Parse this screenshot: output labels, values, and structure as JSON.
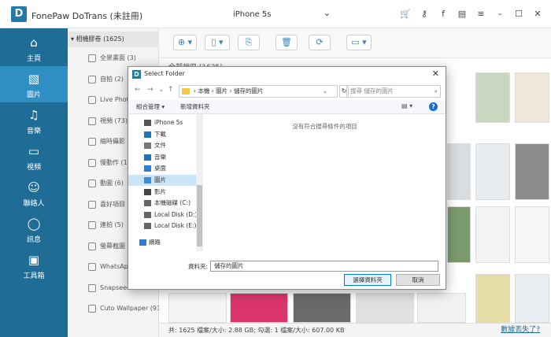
{
  "app": {
    "logo": "D",
    "title": "FonePaw DoTrans (未註冊)",
    "device": "iPhone 5s",
    "title_icons": [
      "cart-icon",
      "key-icon",
      "facebook-icon",
      "chat-icon",
      "menu-icon",
      "minimize-icon",
      "maximize-icon",
      "close-icon"
    ],
    "title_glyphs": [
      "🛒",
      "⚷",
      "f",
      "▤",
      "≡",
      "–",
      "☐",
      "✕"
    ]
  },
  "nav": [
    {
      "label": "主頁",
      "icon": "home-icon",
      "glyph": "⌂"
    },
    {
      "label": "圖片",
      "icon": "photo-icon",
      "glyph": "▧",
      "active": true
    },
    {
      "label": "音樂",
      "icon": "music-icon",
      "glyph": "♫"
    },
    {
      "label": "視頻",
      "icon": "video-icon",
      "glyph": "▭"
    },
    {
      "label": "聯絡人",
      "icon": "contacts-icon",
      "glyph": "☺"
    },
    {
      "label": "訊息",
      "icon": "message-icon",
      "glyph": "◯"
    },
    {
      "label": "工具箱",
      "icon": "toolbox-icon",
      "glyph": "▣"
    }
  ],
  "categories": {
    "header": "▾ 相機膠卷 (1625)",
    "items": [
      "全景畫面 (3)",
      "自拍 (2)",
      "Live Photo",
      "視頻 (73)",
      "縮時攝影 (",
      "慢動作 (1)",
      "動圖 (6)",
      "喜好項目 (",
      "連拍 (5)",
      "螢幕截圖 (",
      "WhatsApp",
      "Snapseed",
      "Cuto Wallpaper (93)"
    ]
  },
  "grid_header": "全部相冊 (1625)",
  "status": {
    "text": "共: 1625 檔案/大小: 2.88 GB; 勾選: 1 檔案/大小: 607.00 KB",
    "link": "數據丟失了?"
  },
  "dialog": {
    "title": "Select Folder",
    "close": "✕",
    "path": [
      "本機",
      "圖片",
      "儲存的圖片"
    ],
    "search_placeholder": "搜尋 儲存的圖片",
    "organize": "組合管理 ▾",
    "new_folder": "新增資料夾",
    "help": "?",
    "empty_msg": "沒有符合搜尋條件的項目",
    "tree": [
      {
        "label": "iPhone 5s",
        "icon": "phone-icon",
        "color": "#555"
      },
      {
        "label": "下載",
        "icon": "download-icon",
        "color": "#1e73be"
      },
      {
        "label": "文件",
        "icon": "document-icon",
        "color": "#777"
      },
      {
        "label": "音樂",
        "icon": "music-icon",
        "color": "#1e73be"
      },
      {
        "label": "桌面",
        "icon": "desktop-icon",
        "color": "#2a7ed6"
      },
      {
        "label": "圖片",
        "icon": "pictures-icon",
        "color": "#3a8fd8",
        "selected": true
      },
      {
        "label": "影片",
        "icon": "video-icon",
        "color": "#444"
      },
      {
        "label": "本機磁碟 (C:)",
        "icon": "drive-icon",
        "color": "#666"
      },
      {
        "label": "Local Disk (D:)",
        "icon": "drive-icon",
        "color": "#666"
      },
      {
        "label": "Local Disk (E:)",
        "icon": "drive-icon",
        "color": "#666"
      },
      {
        "label": "網路",
        "icon": "network-icon",
        "color": "#2a7ed6"
      }
    ],
    "filename_label": "資料夾:",
    "filename_value": "儲存的圖片",
    "select_button": "選擇資料夾",
    "cancel_button": "取消"
  },
  "toolbar_buttons": [
    {
      "name": "add-button",
      "glyph": "⊕ ▾"
    },
    {
      "name": "export-device-button",
      "glyph": "▯ ▾"
    },
    {
      "name": "export-pc-button",
      "glyph": "⎘"
    },
    {
      "name": "delete-button",
      "glyph": "🗑"
    },
    {
      "name": "sync-button",
      "glyph": "⟳"
    },
    {
      "name": "toolbox-button",
      "glyph": "▭ ▾"
    }
  ]
}
